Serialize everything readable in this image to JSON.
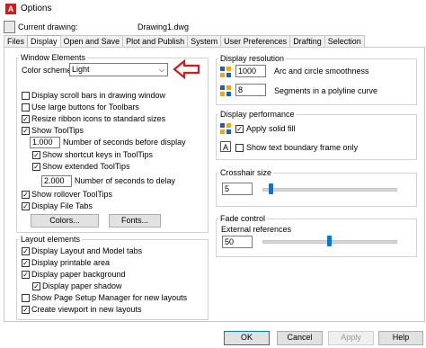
{
  "window": {
    "title": "Options",
    "app_icon_letter": "A"
  },
  "header": {
    "label": "Current drawing:",
    "value": "Drawing1.dwg"
  },
  "tabs": [
    {
      "label": "Files"
    },
    {
      "label": "Display"
    },
    {
      "label": "Open and Save"
    },
    {
      "label": "Plot and Publish"
    },
    {
      "label": "System"
    },
    {
      "label": "User Preferences"
    },
    {
      "label": "Drafting"
    },
    {
      "label": "Selection"
    }
  ],
  "window_elements": {
    "title": "Window Elements",
    "color_scheme_label": "Color scheme:",
    "color_scheme_value": "Light",
    "annotation_arrow_color": "#d11a1a",
    "checks": {
      "scroll_bars": {
        "label": "Display scroll bars in drawing window",
        "checked": false
      },
      "large_buttons": {
        "label": "Use large buttons for Toolbars",
        "checked": false
      },
      "resize_ribbon": {
        "label": "Resize ribbon icons to standard sizes",
        "checked": true
      },
      "show_tooltips": {
        "label": "Show ToolTips",
        "checked": true
      },
      "shortcut_keys": {
        "label": "Show shortcut keys in ToolTips",
        "checked": true
      },
      "extended_tooltips": {
        "label": "Show extended ToolTips",
        "checked": true
      },
      "rollover": {
        "label": "Show rollover ToolTips",
        "checked": true
      },
      "file_tabs": {
        "label": "Display File Tabs",
        "checked": true
      }
    },
    "tooltip_delay_value": "1.000",
    "tooltip_delay_label": "Number of seconds before display",
    "extended_delay_value": "2.000",
    "extended_delay_label": "Number of seconds to delay",
    "colors_button": "Colors...",
    "fonts_button": "Fonts..."
  },
  "layout_elements": {
    "title": "Layout elements",
    "checks": {
      "layout_model_tabs": {
        "label": "Display Layout and Model tabs",
        "checked": true
      },
      "printable_area": {
        "label": "Display printable area",
        "checked": true
      },
      "paper_background": {
        "label": "Display paper background",
        "checked": true
      },
      "paper_shadow": {
        "label": "Display paper shadow",
        "checked": true
      },
      "page_setup_manager": {
        "label": "Show Page Setup Manager for new layouts",
        "checked": false
      },
      "create_viewport": {
        "label": "Create viewport in new layouts",
        "checked": true
      }
    }
  },
  "display_resolution": {
    "title": "Display resolution",
    "arc_value": "1000",
    "arc_label": "Arc and circle smoothness",
    "polyline_value": "8",
    "polyline_label": "Segments in a polyline curve"
  },
  "display_performance": {
    "title": "Display performance",
    "solid_fill": {
      "label": "Apply solid fill",
      "checked": true
    },
    "text_boundary": {
      "label": "Show text boundary frame only",
      "checked": false
    }
  },
  "crosshair": {
    "title": "Crosshair size",
    "value": "5",
    "slider_fraction": 0.05
  },
  "fade_control": {
    "title": "Fade control",
    "external_label": "External references",
    "value": "50",
    "slider_fraction": 0.5
  },
  "footer": {
    "ok": "OK",
    "cancel": "Cancel",
    "apply": "Apply",
    "help": "Help"
  },
  "icons": {
    "arc": "arc-smoothness-icon",
    "polyline": "polyline-icon",
    "solid_fill": "solid-fill-icon",
    "text_frame": "text-boundary-icon"
  }
}
